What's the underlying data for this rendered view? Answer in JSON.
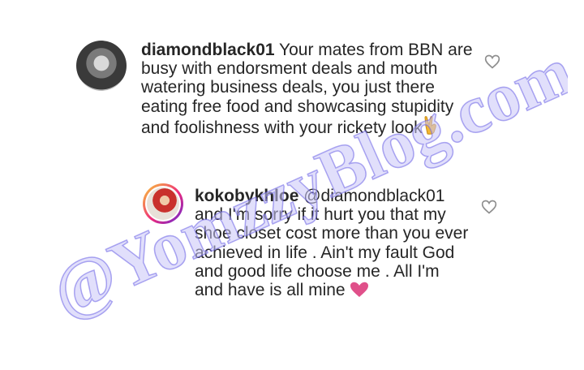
{
  "comments": [
    {
      "username": "diamondblack01",
      "text": "Your mates from BBN are busy with endorsment deals and mouth watering business deals, you just there eating free food and showcasing stupidity and foolishness with your rickety look",
      "emoji": "✌"
    },
    {
      "username": "kokobykhloe",
      "mention": "@diamondblack01",
      "text": "and I'm sorry if it hurt you that my shoe closet cost more than you ever achieved in life . Ain't my fault God and good life choose me . All I'm and have is all mine",
      "emoji": "❤"
    }
  ],
  "watermark": "@YomzzyBlog.com",
  "icons": {
    "like": "heart-outline-icon",
    "peace": "victory-hand-icon",
    "love": "pink-heart-icon"
  },
  "colors": {
    "text": "#262626",
    "watermark": "#6c63e6",
    "love": "#e0508a",
    "peace": "#f0b429"
  }
}
